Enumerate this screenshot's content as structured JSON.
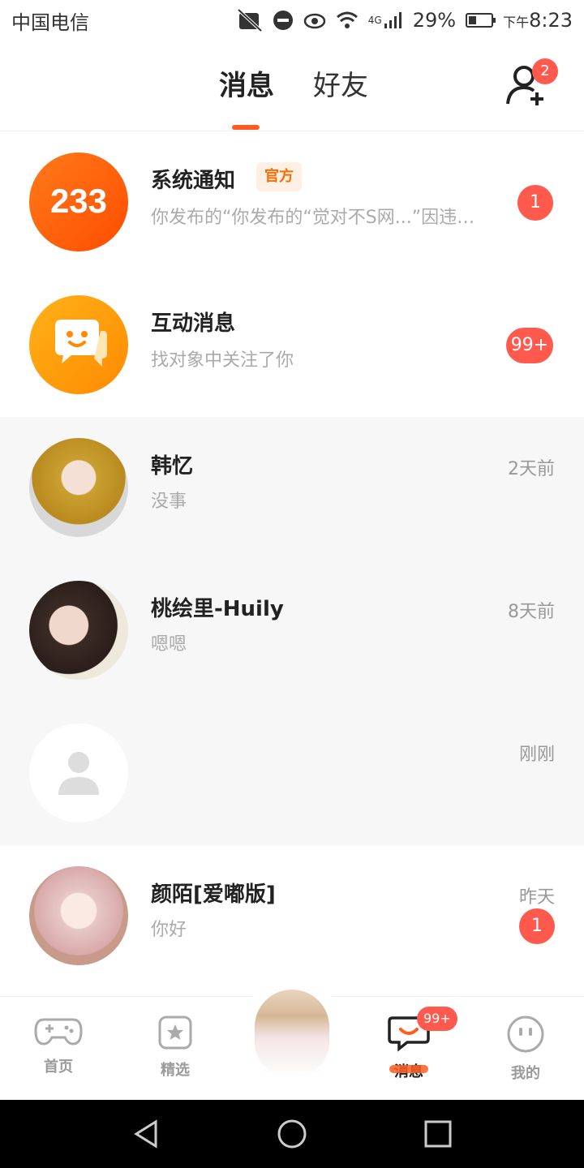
{
  "status_bar": {
    "carrier": "中国电信",
    "battery": "29%",
    "time_prefix": "下午",
    "time": "8:23",
    "network": "4G"
  },
  "header": {
    "tabs": [
      {
        "label": "消息"
      },
      {
        "label": "好友"
      }
    ],
    "friend_request_count": "2"
  },
  "messages": [
    {
      "title": "系统通知",
      "tag": "官方",
      "subtitle": "你发布的“你发布的“觉对不S网...”因违反...",
      "badge": "1"
    },
    {
      "title": "互动消息",
      "subtitle": "找对象中关注了你",
      "badge": "99+"
    },
    {
      "title": "韩忆",
      "subtitle": "没事",
      "time": "2天前"
    },
    {
      "title": "桃绘里-Huily",
      "subtitle": "嗯嗯",
      "time": "8天前"
    },
    {
      "title": "",
      "subtitle": "",
      "time": "刚刚"
    },
    {
      "title": "颜陌[爱嘟版]",
      "subtitle": "你好",
      "time": "昨天",
      "badge": "1"
    }
  ],
  "avatar_logo_text": "233",
  "tabbar": {
    "items": [
      {
        "label": "首页"
      },
      {
        "label": "精选"
      },
      {
        "label": "消息"
      },
      {
        "label": "我的"
      }
    ],
    "message_badge": "99+"
  },
  "colors": {
    "accent": "#ff5a1f",
    "badge": "#ff5a4d",
    "official_bg": "#fff0e6"
  }
}
